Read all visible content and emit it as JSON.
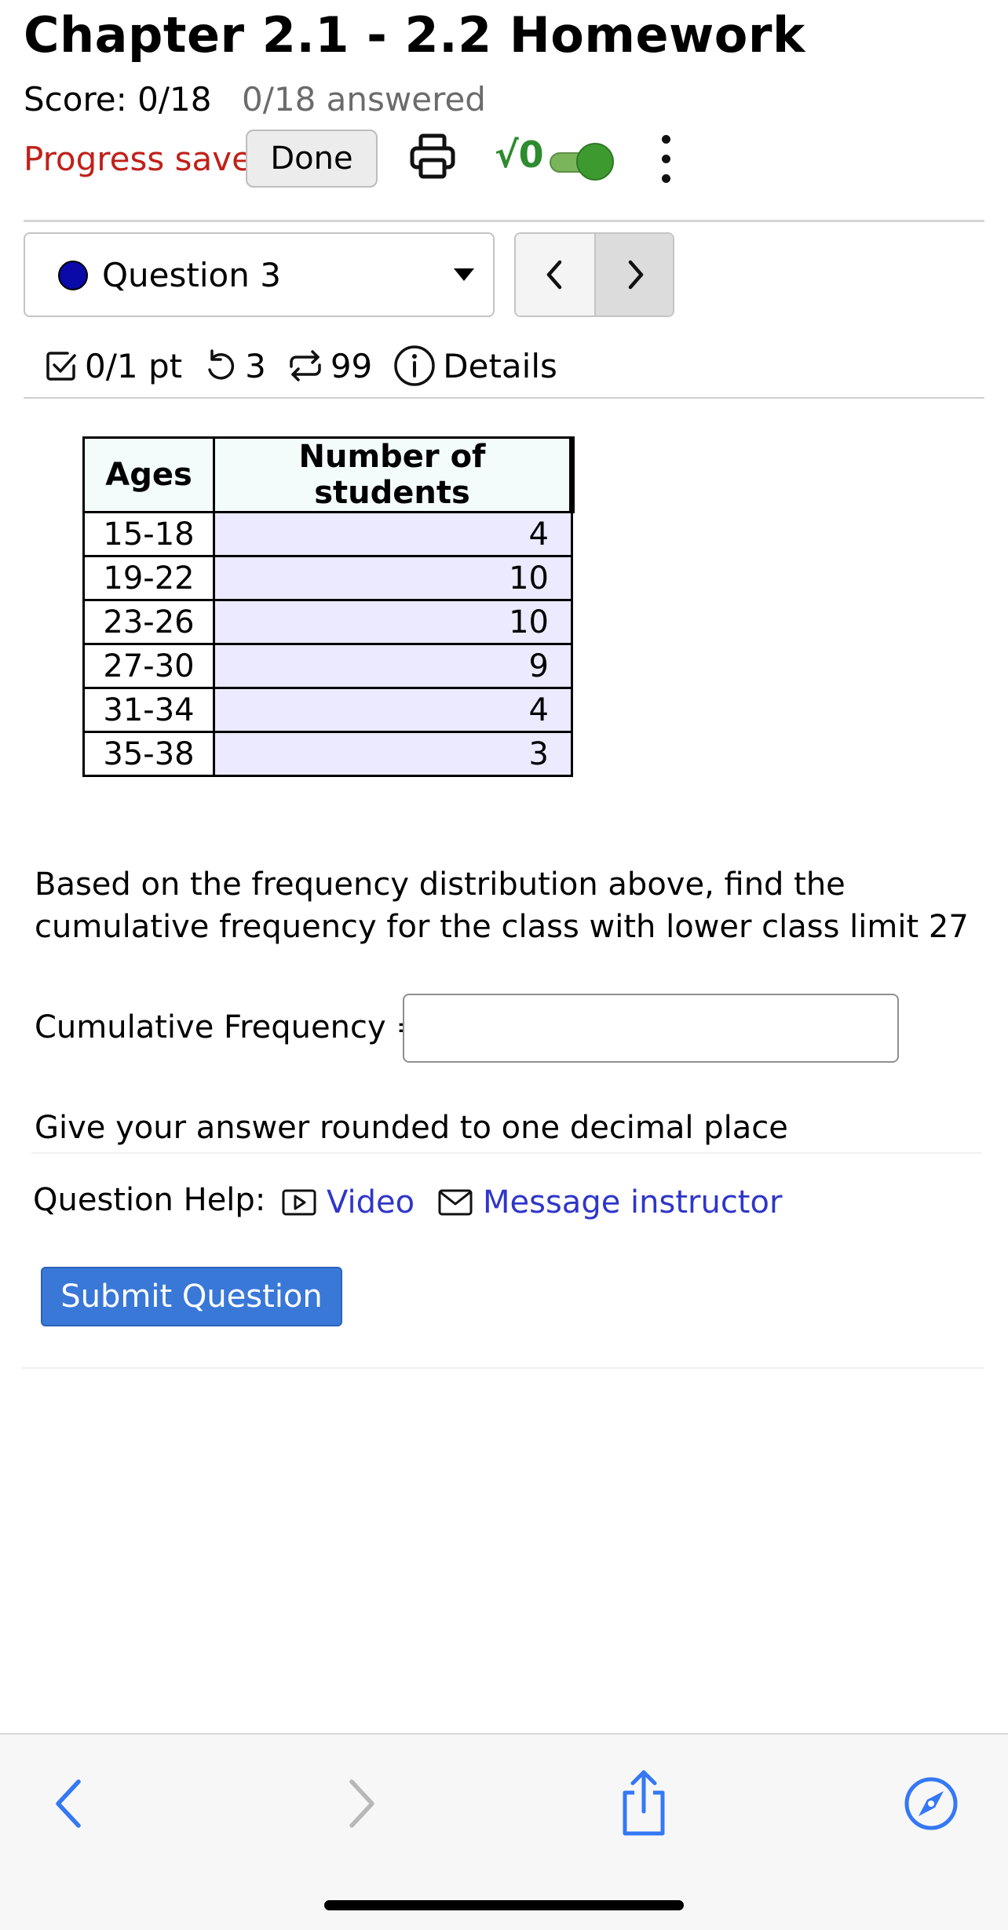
{
  "header": {
    "title": "Chapter 2.1 - 2.2 Homework",
    "score": "Score: 0/18",
    "answered": "0/18 answered",
    "progress_status": "Progress saved",
    "done_label": "Done",
    "math_toggle_label": "√0",
    "math_toggle_on": true
  },
  "question_nav": {
    "selected": "Question 3",
    "prev_symbol": "‹",
    "next_symbol": "›"
  },
  "stats": {
    "points": "0/1 pt",
    "retries": "3",
    "versions": "99",
    "details_label": "Details"
  },
  "table": {
    "headers": [
      "Ages",
      "Number of students"
    ],
    "rows": [
      [
        "15-18",
        "4"
      ],
      [
        "19-22",
        "10"
      ],
      [
        "23-26",
        "10"
      ],
      [
        "27-30",
        "9"
      ],
      [
        "31-34",
        "4"
      ],
      [
        "35-38",
        "3"
      ]
    ]
  },
  "question": {
    "prompt": "Based on the frequency distribution above, find the cumulative frequency for the class with lower class limit 27",
    "answer_label": "Cumulative Frequency =",
    "answer_value": "",
    "note": "Give your answer rounded to one decimal place"
  },
  "help": {
    "label": "Question Help:",
    "video_label": "Video",
    "message_label": "Message instructor"
  },
  "submit_label": "Submit Question",
  "colors": {
    "progress_saved": "#c0211a",
    "link": "#2f36c9",
    "submit_bg": "#3a78d8",
    "toggle_on": "#3d9a2f",
    "table_cell_bg": "#ebeaff",
    "toolbar_icon": "#3478f6"
  },
  "browser_toolbar": {
    "icons": [
      "back-icon",
      "forward-icon",
      "share-icon",
      "compass-icon"
    ]
  }
}
